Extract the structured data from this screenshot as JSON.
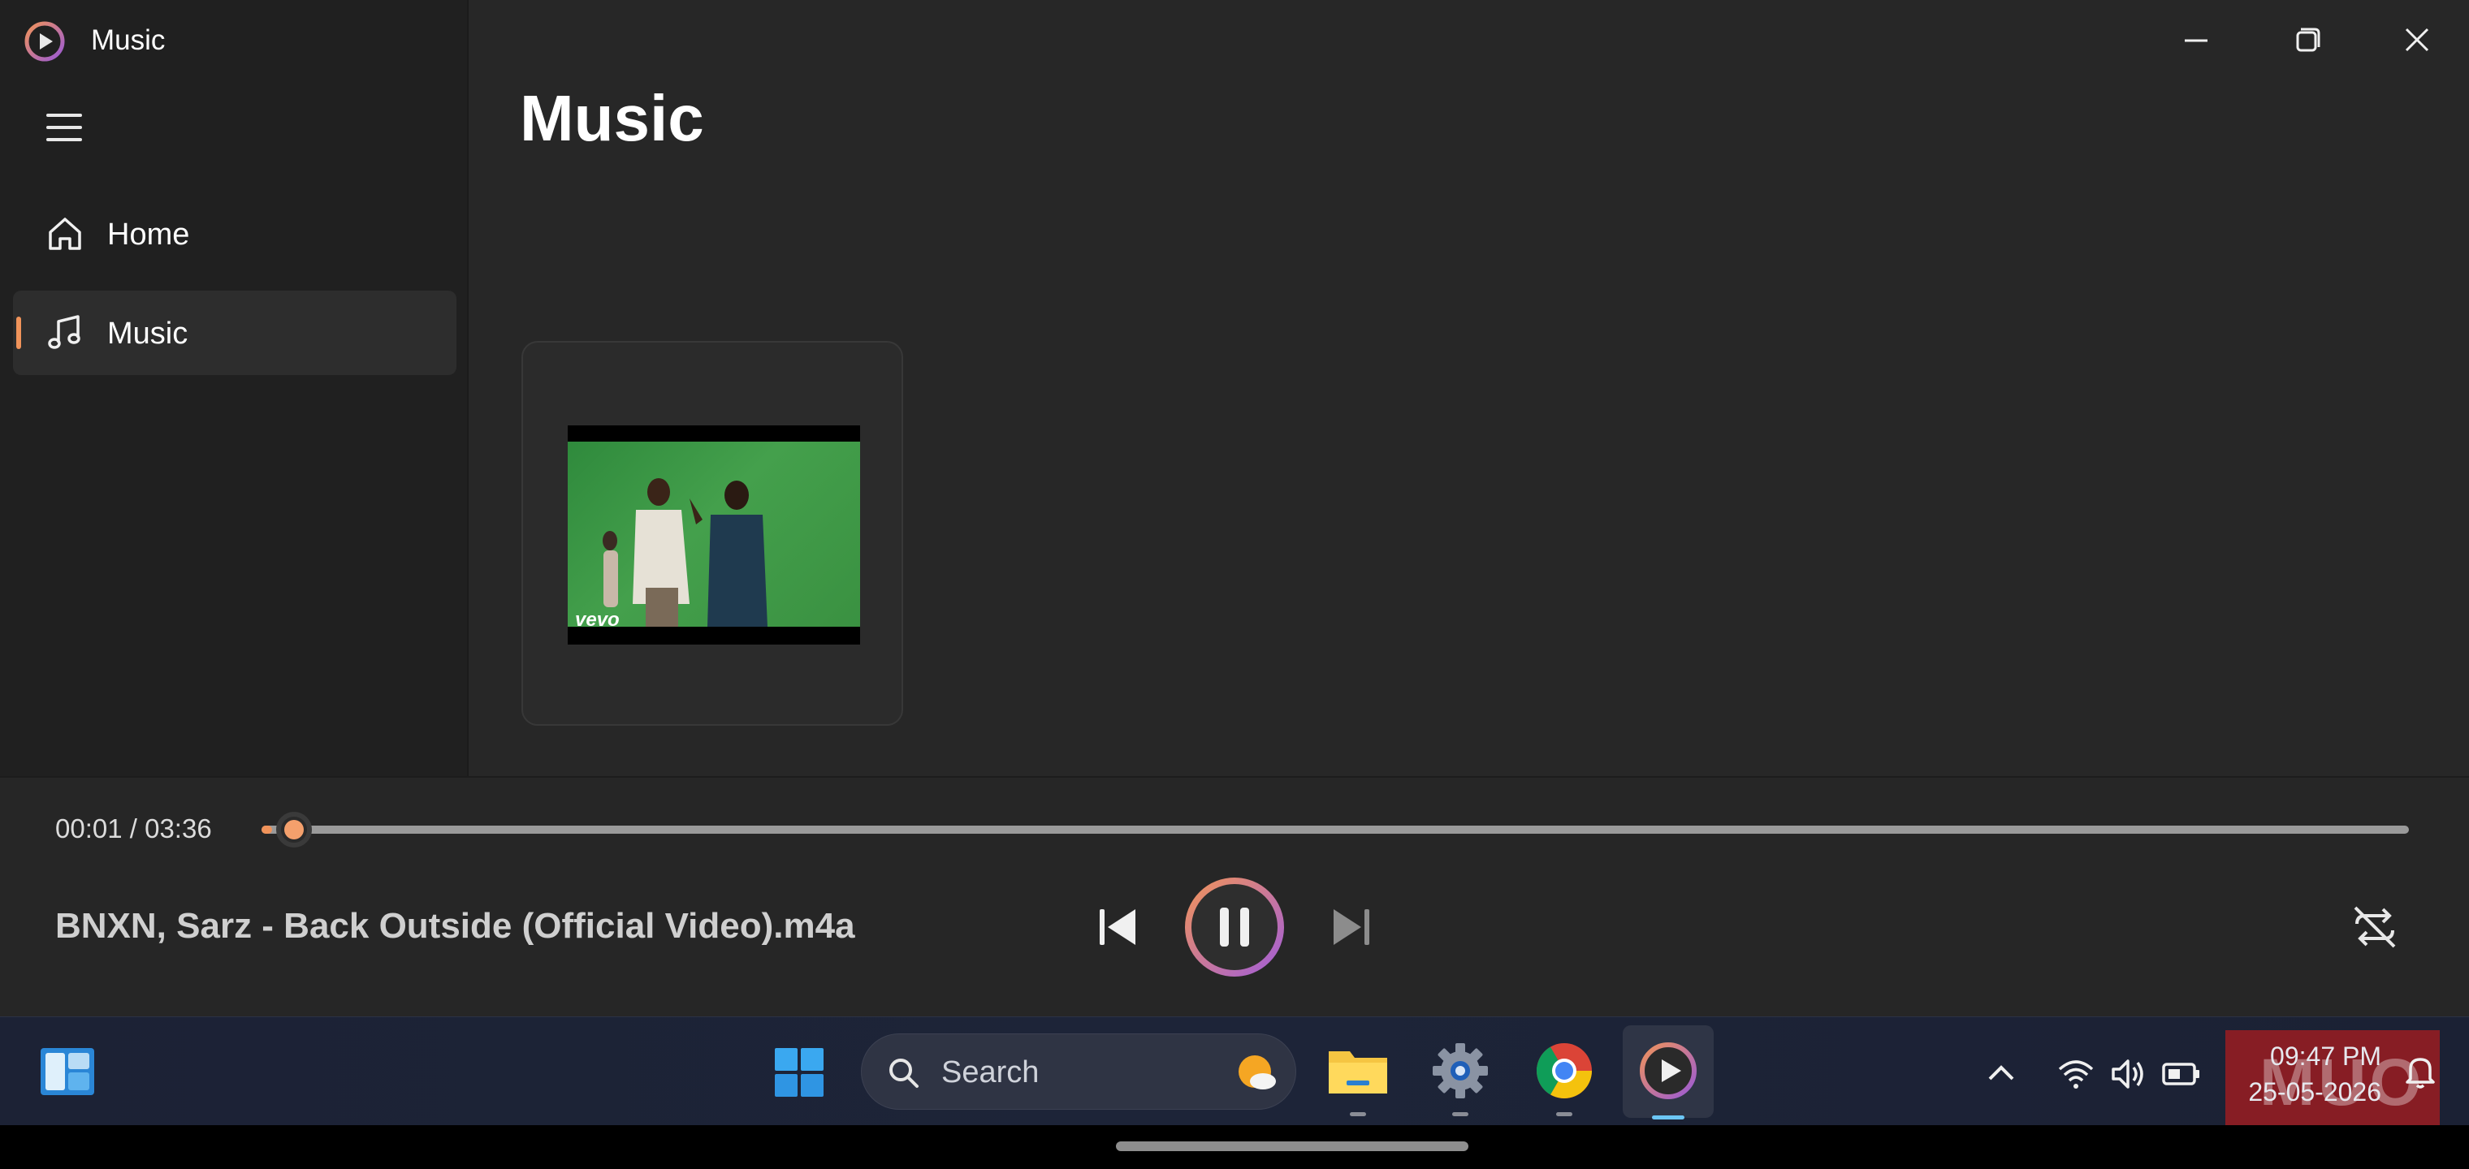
{
  "window": {
    "app_title": "Music",
    "controls": [
      "minimize-icon",
      "restore-icon",
      "close-icon"
    ]
  },
  "sidebar": {
    "items": [
      {
        "label": "Home",
        "icon": "home-icon",
        "selected": false
      },
      {
        "label": "Music",
        "icon": "music-note-icon",
        "selected": true
      }
    ]
  },
  "main": {
    "page_title": "Music",
    "album_card": {
      "thumbnail_logo": "vevo"
    }
  },
  "player": {
    "time_display": "00:01 / 03:36",
    "progress_fraction": 0.005,
    "track_title": "BNXN, Sarz - Back Outside (Official Video).m4a",
    "state": "playing",
    "accent_color": "#f0935a"
  },
  "taskbar": {
    "search_placeholder": "Search",
    "pinned_apps": [
      "file-explorer-icon",
      "settings-icon",
      "chrome-icon",
      "media-player-icon"
    ],
    "active_app": "media-player-icon",
    "clock_time": "09:47 PM",
    "clock_date": "25-05-2026",
    "watermark_text": "MUO"
  }
}
